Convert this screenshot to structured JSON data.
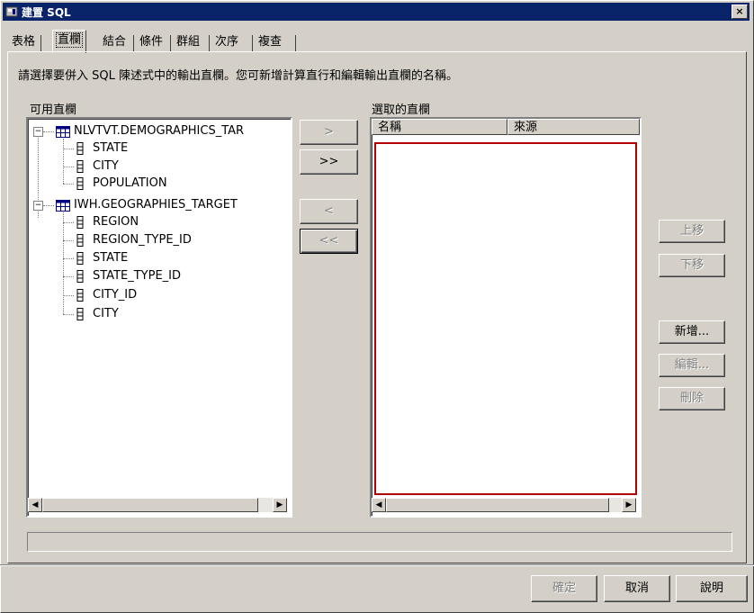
{
  "window": {
    "title": "建置 SQL",
    "close": "×"
  },
  "tabs": [
    {
      "label": "表格"
    },
    {
      "label": "直欄"
    },
    {
      "label": "結合"
    },
    {
      "label": "條件"
    },
    {
      "label": "群組"
    },
    {
      "label": "次序"
    },
    {
      "label": "複查"
    }
  ],
  "instructions": "請選擇要併入 SQL 陳述式中的輸出直欄。您可新增計算直行和編輯輸出直欄的名稱。",
  "available": {
    "label": "可用直欄",
    "tables": [
      {
        "name": "NLVTVT.DEMOGRAPHICS_TAR",
        "expander": "−",
        "columns": [
          "STATE",
          "CITY",
          "POPULATION"
        ]
      },
      {
        "name": "IWH.GEOGRAPHIES_TARGET",
        "expander": "−",
        "columns": [
          "REGION",
          "REGION_TYPE_ID",
          "STATE",
          "STATE_TYPE_ID",
          "CITY_ID",
          "CITY"
        ]
      }
    ]
  },
  "move_buttons": {
    "add_one": ">",
    "add_all": ">>",
    "remove_one": "<",
    "remove_all": "<<"
  },
  "selected": {
    "label": "選取的直欄",
    "col_name": "名稱",
    "col_source": "來源"
  },
  "side_buttons": {
    "up": "上移",
    "down": "下移",
    "add": "新增...",
    "edit": "編輯...",
    "delete": "刪除"
  },
  "status_text": "",
  "footer": {
    "ok": "確定",
    "cancel": "取消",
    "help": "說明"
  },
  "colors": {
    "titlebar": "#0a246a",
    "face": "#d4d0c8",
    "selected_border": "#b00000"
  },
  "icons": {
    "close": "close-icon",
    "app": "app-icon",
    "table": "table-icon",
    "column": "column-icon",
    "scroll_left": "arrow-left-icon",
    "scroll_right": "arrow-right-icon"
  }
}
